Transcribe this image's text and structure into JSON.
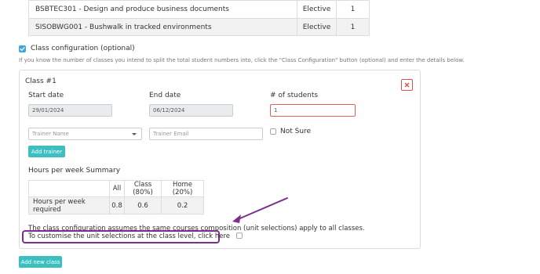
{
  "units": [
    {
      "code_name": "BSBTEC301 - Design and produce business documents",
      "type": "Elective",
      "count": "1"
    },
    {
      "code_name": "SISOBWG001 - Bushwalk in tracked environments",
      "type": "Elective",
      "count": "1"
    }
  ],
  "class_config": {
    "checked": true,
    "label": "Class configuration (optional)",
    "help": "If you know the number of classes you intend to split the total student numbers into, click the \"Class Configuration\" button (optional) and enter the details below."
  },
  "class_panel": {
    "title": "Class #1",
    "start_date_label": "Start date",
    "start_date_value": "29/01/2024",
    "end_date_label": "End date",
    "end_date_value": "06/12/2024",
    "students_label": "# of students",
    "students_value": "1",
    "trainer_name_placeholder": "Trainer Name",
    "trainer_email_placeholder": "Trainer Email",
    "not_sure_label": "Not Sure",
    "add_trainer_label": "Add trainer",
    "summary_title": "Hours per week Summary",
    "summary": {
      "headers": [
        "",
        "All",
        "Class (80%)",
        "Home (20%)"
      ],
      "row_label": "Hours per week required",
      "values": [
        "0.8",
        "0.6",
        "0.2"
      ]
    },
    "note": "The class configuration assumes the same courses composition (unit selections) apply to all classes.",
    "customise_label": "To customise the unit selections at the class level, click here"
  },
  "add_new_class_label": "Add new class",
  "colors": {
    "accent_blue": "#3fa7df",
    "teal_button": "#3cbfbf",
    "danger_red": "#d9534f",
    "annotation_purple": "#7b2e8c"
  }
}
